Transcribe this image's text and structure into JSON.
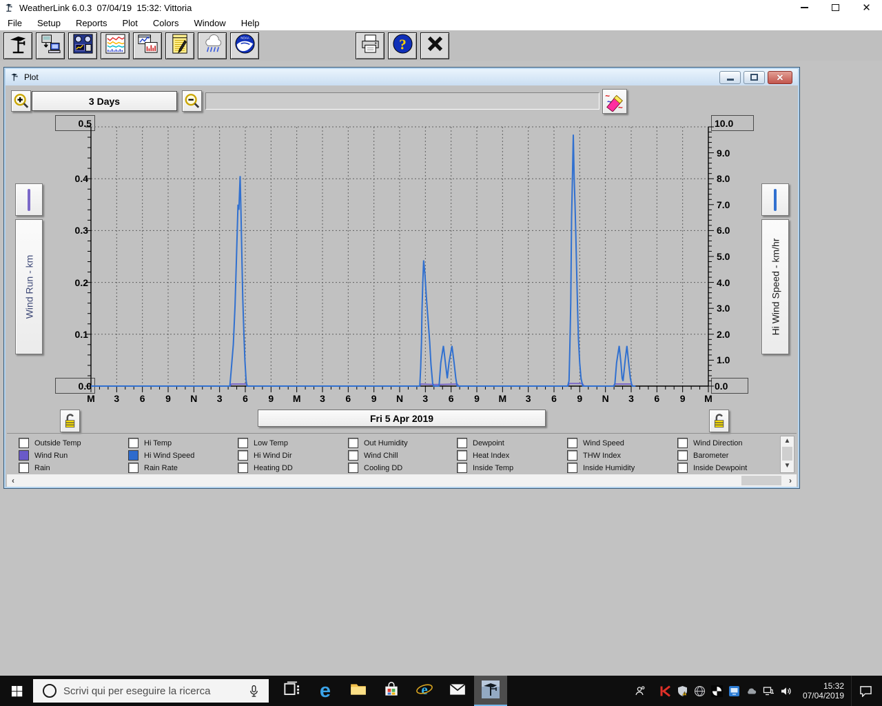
{
  "window": {
    "title": "WeatherLink 6.0.3  07/04/19  15:32: Vittoria",
    "controls": [
      "minimize",
      "maximize",
      "close"
    ]
  },
  "menu": {
    "items": [
      "File",
      "Setup",
      "Reports",
      "Plot",
      "Colors",
      "Window",
      "Help"
    ]
  },
  "toolbar": {
    "left_icons": [
      "station",
      "download",
      "bulletin",
      "strip-chart",
      "plot",
      "reports",
      "rain",
      "noaa"
    ],
    "right_icons": [
      "print",
      "help",
      "close"
    ]
  },
  "plot_window": {
    "title": "Plot",
    "controls": [
      "minimize",
      "restore",
      "close"
    ],
    "range_button": "3 Days",
    "date_label": "Fri 5 Apr 2019",
    "left_axis": {
      "title": "Wind Run - km",
      "title_color": "#3f4a78",
      "max_label": "0.5",
      "min_label": "0.0",
      "tick_labels": [
        "0.4",
        "0.3",
        "0.2",
        "0.1"
      ],
      "sample_color": "#7b68c8"
    },
    "right_axis": {
      "title": "Hi Wind Speed - km/hr",
      "title_color": "#1a1a1a",
      "max_label": "10.0",
      "min_label": "0.0",
      "tick_labels": [
        "9.0",
        "8.0",
        "7.0",
        "6.0",
        "5.0",
        "4.0",
        "3.0",
        "2.0",
        "1.0"
      ],
      "sample_color": "#3070d0"
    },
    "x_axis_labels": [
      "M",
      "3",
      "6",
      "9",
      "N",
      "3",
      "6",
      "9",
      "M",
      "3",
      "6",
      "9",
      "N",
      "3",
      "6",
      "9",
      "M",
      "3",
      "6",
      "9",
      "N",
      "3",
      "6",
      "9",
      "M"
    ],
    "checkbox_columns": [
      {
        "items": [
          {
            "label": "Outside Temp",
            "checked": false
          },
          {
            "label": "Wind Run",
            "checked": true,
            "color": "#6a5ac9"
          },
          {
            "label": "Rain",
            "checked": false
          }
        ]
      },
      {
        "items": [
          {
            "label": "Hi Temp",
            "checked": false
          },
          {
            "label": "Hi Wind Speed",
            "checked": true,
            "color": "#2e6bcd"
          },
          {
            "label": "Rain Rate",
            "checked": false
          }
        ]
      },
      {
        "items": [
          {
            "label": "Low Temp",
            "checked": false
          },
          {
            "label": "Hi Wind Dir",
            "checked": false
          },
          {
            "label": "Heating DD",
            "checked": false
          }
        ]
      },
      {
        "items": [
          {
            "label": "Out Humidity",
            "checked": false
          },
          {
            "label": "Wind Chill",
            "checked": false
          },
          {
            "label": "Cooling DD",
            "checked": false
          }
        ]
      },
      {
        "items": [
          {
            "label": "Dewpoint",
            "checked": false
          },
          {
            "label": "Heat Index",
            "checked": false
          },
          {
            "label": "Inside Temp",
            "checked": false
          }
        ]
      },
      {
        "items": [
          {
            "label": "Wind Speed",
            "checked": false
          },
          {
            "label": "THW Index",
            "checked": false
          },
          {
            "label": "Inside Humidity",
            "checked": false
          }
        ]
      },
      {
        "items": [
          {
            "label": "Wind Direction",
            "checked": false
          },
          {
            "label": "Barometer",
            "checked": false
          },
          {
            "label": "Inside Dewpoint",
            "checked": false
          }
        ]
      }
    ]
  },
  "chart_data": {
    "type": "line",
    "title": "Wind plot, 3 days ending Fri 5 Apr 2019",
    "x_range": [
      0,
      72
    ],
    "x_unit": "hours over 3 days; ticks every hour, labels every 3 hours (M=midnight, N=noon)",
    "grid": "dashed gridlines every 3 hours vertically and every 2.0 km/hr (0.1 km) horizontally",
    "left_axis": {
      "label": "Wind Run - km",
      "range": [
        0,
        0.5
      ]
    },
    "right_axis": {
      "label": "Hi Wind Speed - km/hr",
      "range": [
        0,
        10
      ]
    },
    "data_ends_at_hour": 63.5,
    "series": [
      {
        "name": "Wind Run",
        "axis": "left",
        "color": "#7b68c8",
        "points": [
          [
            0,
            0
          ],
          [
            16.2,
            0
          ],
          [
            16.4,
            0.004
          ],
          [
            18.1,
            0.004
          ],
          [
            18.3,
            0
          ],
          [
            38.3,
            0
          ],
          [
            38.5,
            0.004
          ],
          [
            39.9,
            0.003
          ],
          [
            40.6,
            0.003
          ],
          [
            42.7,
            0.004
          ],
          [
            42.9,
            0
          ],
          [
            55.6,
            0
          ],
          [
            55.8,
            0.005
          ],
          [
            57.3,
            0.005
          ],
          [
            57.5,
            0
          ],
          [
            60.9,
            0
          ],
          [
            61.1,
            0.004
          ],
          [
            63.0,
            0.004
          ],
          [
            63.2,
            0
          ],
          [
            63.5,
            0
          ]
        ]
      },
      {
        "name": "Hi Wind Speed",
        "axis": "right",
        "color": "#3070d0",
        "points": [
          [
            0,
            0
          ],
          [
            16.2,
            0
          ],
          [
            16.35,
            0.6
          ],
          [
            16.6,
            1.6
          ],
          [
            16.8,
            3.1
          ],
          [
            16.95,
            4.7
          ],
          [
            17.05,
            5.9
          ],
          [
            17.15,
            7.0
          ],
          [
            17.25,
            6.8
          ],
          [
            17.4,
            8.1
          ],
          [
            17.5,
            6.6
          ],
          [
            17.6,
            5.0
          ],
          [
            17.7,
            3.4
          ],
          [
            17.85,
            1.9
          ],
          [
            17.95,
            1.0
          ],
          [
            18.1,
            0.2
          ],
          [
            18.2,
            0
          ],
          [
            38.35,
            0
          ],
          [
            38.45,
            0.7
          ],
          [
            38.55,
            1.7
          ],
          [
            38.6,
            2.9
          ],
          [
            38.7,
            4.0
          ],
          [
            38.8,
            4.85
          ],
          [
            38.95,
            4.3
          ],
          [
            39.1,
            3.5
          ],
          [
            39.3,
            2.6
          ],
          [
            39.5,
            1.7
          ],
          [
            39.65,
            0.85
          ],
          [
            39.85,
            0.1
          ],
          [
            39.95,
            0
          ],
          [
            40.6,
            0
          ],
          [
            40.8,
            0.9
          ],
          [
            41.1,
            1.55
          ],
          [
            41.35,
            0.85
          ],
          [
            41.55,
            0.3
          ],
          [
            41.75,
            0.9
          ],
          [
            42.1,
            1.55
          ],
          [
            42.35,
            0.9
          ],
          [
            42.55,
            0.3
          ],
          [
            42.7,
            0
          ],
          [
            55.6,
            0
          ],
          [
            55.75,
            0.2
          ],
          [
            55.85,
            1.5
          ],
          [
            55.95,
            3.2
          ],
          [
            56.0,
            4.8
          ],
          [
            56.05,
            6.5
          ],
          [
            56.15,
            8.1
          ],
          [
            56.25,
            9.7
          ],
          [
            56.35,
            8.1
          ],
          [
            56.45,
            7.0
          ],
          [
            56.55,
            5.8
          ],
          [
            56.65,
            4.3
          ],
          [
            56.75,
            3.0
          ],
          [
            56.85,
            1.8
          ],
          [
            57.0,
            0.9
          ],
          [
            57.15,
            0.3
          ],
          [
            57.35,
            0
          ],
          [
            61.0,
            0
          ],
          [
            61.1,
            0.1
          ],
          [
            61.3,
            0.9
          ],
          [
            61.6,
            1.55
          ],
          [
            61.8,
            0.9
          ],
          [
            61.95,
            0.3
          ],
          [
            62.05,
            0.2
          ],
          [
            62.3,
            1.0
          ],
          [
            62.5,
            1.55
          ],
          [
            62.7,
            0.9
          ],
          [
            62.9,
            0.3
          ],
          [
            63.1,
            0
          ],
          [
            63.5,
            0
          ]
        ]
      }
    ]
  },
  "taskbar": {
    "search_text": "Scrivi qui per eseguire la ricerca",
    "app_icons": [
      "task-view",
      "edge",
      "file-explorer",
      "store",
      "internet-explorer",
      "mail",
      "weatherlink"
    ],
    "active_app": "weatherlink",
    "tray_icons": [
      "people",
      "kaspersky",
      "defender",
      "globe",
      "pinwheel",
      "remote-app",
      "onedrive",
      "network",
      "volume"
    ],
    "time": "15:32",
    "date": "07/04/2019"
  }
}
